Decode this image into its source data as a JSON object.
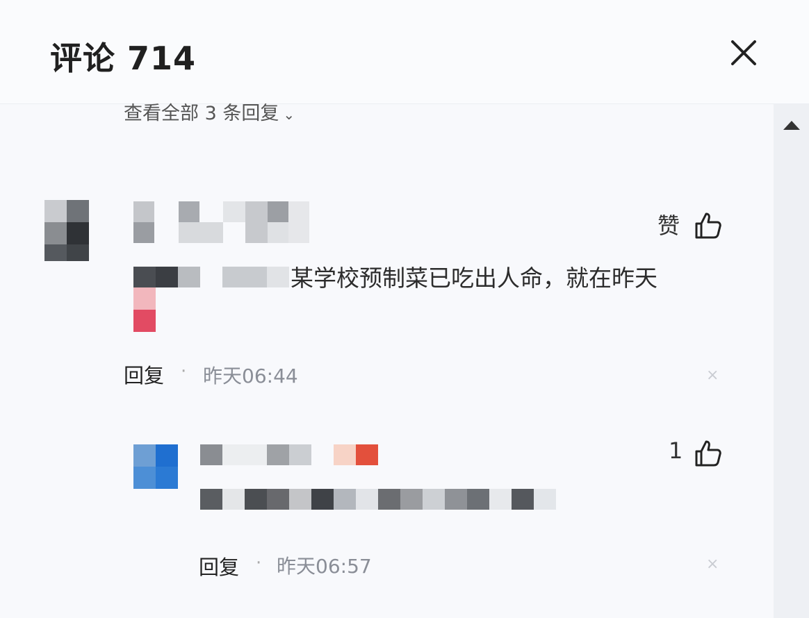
{
  "header": {
    "title": "评论 714"
  },
  "view_all_replies": {
    "label": "查看全部 3 条回复",
    "chevron": "chevron-down-icon"
  },
  "comments": [
    {
      "text": "某学校预制菜已吃出人命，就在昨天",
      "like_label": "赞",
      "reply_label": "回复",
      "separator": "·",
      "time": "昨天06:44",
      "delete_label": "×"
    },
    {
      "like_count": "1",
      "reply_label": "回复",
      "separator": "·",
      "time": "昨天06:57",
      "delete_label": "×"
    }
  ],
  "icons": {
    "close": "close-icon",
    "like": "thumbs-up-icon",
    "scroll_up": "scroll-up-arrow-icon"
  },
  "colors": {
    "text": "#222222",
    "muted": "#8a8e97",
    "accent_blue": "#2f7fd6",
    "accent_red": "#e3503c"
  }
}
